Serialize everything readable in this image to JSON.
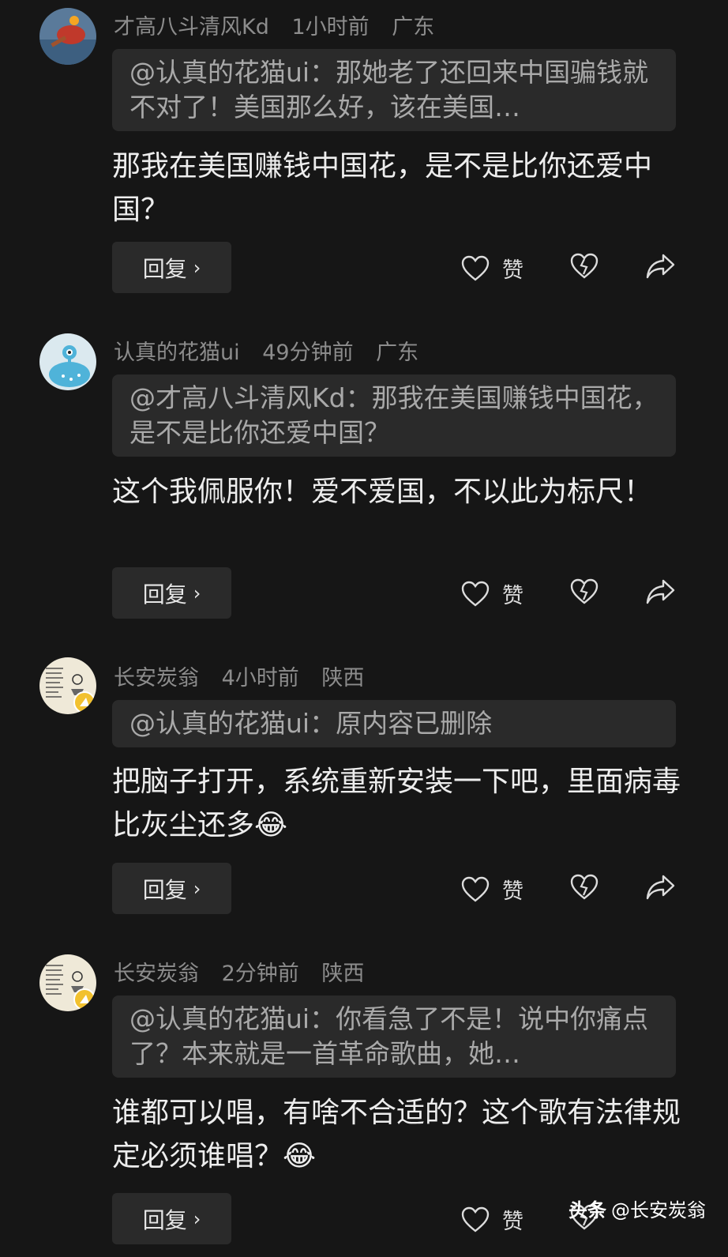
{
  "comments": [
    {
      "username": "才高八斗清风Kd",
      "time": "1小时前",
      "location": "广东",
      "quote": "@认真的花猫ui：那她老了还回来中国骗钱就不对了！美国那么好，该在美国…",
      "text": "那我在美国赚钱中国花，是不是比你还爱中国？",
      "reply_label": "回复",
      "like_label": "赞",
      "avatar_icon": "ping-pong-paddle-avatar"
    },
    {
      "username": "认真的花猫ui",
      "time": "49分钟前",
      "location": "广东",
      "quote": "@才高八斗清风Kd：那我在美国赚钱中国花，是不是比你还爱中国？",
      "text": "这个我佩服你！爱不爱国，不以此为标尺！",
      "reply_label": "回复",
      "like_label": "赞",
      "avatar_icon": "blue-creature-avatar"
    },
    {
      "username": "长安炭翁",
      "time": "4小时前",
      "location": "陕西",
      "quote": "@认真的花猫ui：原内容已删除",
      "text": "把脑子打开，系统重新安装一下吧，里面病毒比灰尘还多😂",
      "reply_label": "回复",
      "like_label": "赞",
      "avatar_icon": "calligraphy-avatar"
    },
    {
      "username": "长安炭翁",
      "time": "2分钟前",
      "location": "陕西",
      "quote": "@认真的花猫ui：你看急了不是！说中你痛点了？本来就是一首革命歌曲，她…",
      "text": "谁都可以唱，有啥不合适的？这个歌有法律规定必须谁唱？😂",
      "reply_label": "回复",
      "like_label": "赞",
      "avatar_icon": "calligraphy-avatar"
    }
  ],
  "watermark": {
    "brand": "头条",
    "handle": "@长安炭翁"
  },
  "colors": {
    "background": "#161616",
    "quote_bg": "#2a2a2a",
    "meta_text": "#8c8c8c",
    "badge": "#f2c12e"
  }
}
